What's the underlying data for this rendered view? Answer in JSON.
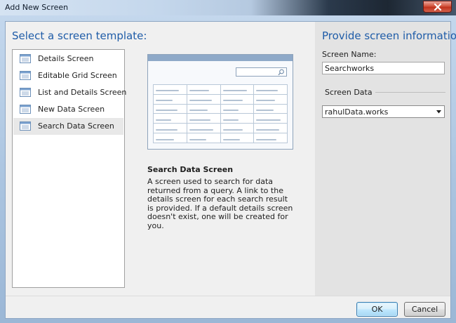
{
  "window": {
    "title": "Add New Screen",
    "close_icon": "close-icon"
  },
  "left": {
    "heading": "Select a screen template:",
    "templates": [
      {
        "label": "Details Screen",
        "icon": "screen-template-icon"
      },
      {
        "label": "Editable Grid Screen",
        "icon": "screen-template-icon"
      },
      {
        "label": "List and Details Screen",
        "icon": "screen-template-icon"
      },
      {
        "label": "New Data Screen",
        "icon": "screen-template-icon"
      },
      {
        "label": "Search Data Screen",
        "icon": "screen-template-icon"
      }
    ],
    "selected_index": 4
  },
  "preview": {
    "search_icon": "search-icon",
    "description_title": "Search Data Screen",
    "description": "A screen used to search for data returned from a query.  A link to the details screen for each search result is provided.  If a default details screen doesn't exist, one will be created for you."
  },
  "right": {
    "heading": "Provide screen information:",
    "screen_name_label": "Screen Name:",
    "screen_name_value": "Searchworks",
    "screen_data_label": "Screen Data",
    "screen_data_value": "rahulData.works"
  },
  "footer": {
    "ok_label": "OK",
    "cancel_label": "Cancel"
  },
  "colors": {
    "heading_blue": "#1f5ca8",
    "selection_gray": "#e8e8e8",
    "ok_border": "#3c7fb1"
  }
}
